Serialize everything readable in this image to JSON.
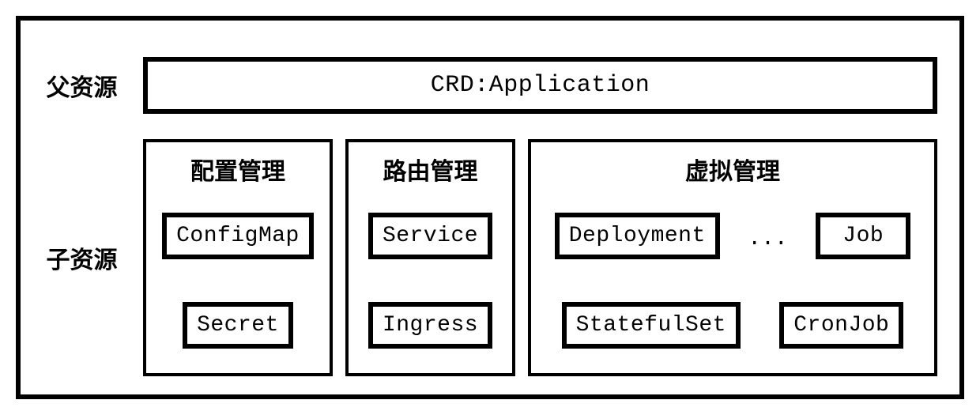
{
  "labels": {
    "parent": "父资源",
    "child": "子资源"
  },
  "parent_box": "CRD:Application",
  "groups": {
    "config": {
      "title": "配置管理",
      "items": [
        "ConfigMap",
        "Secret"
      ]
    },
    "route": {
      "title": "路由管理",
      "items": [
        "Service",
        "Ingress"
      ]
    },
    "virtual": {
      "title": "虚拟管理",
      "row1": [
        "Deployment",
        "Job"
      ],
      "row2": [
        "StatefulSet",
        "CronJob"
      ],
      "ellipsis": "..."
    }
  }
}
